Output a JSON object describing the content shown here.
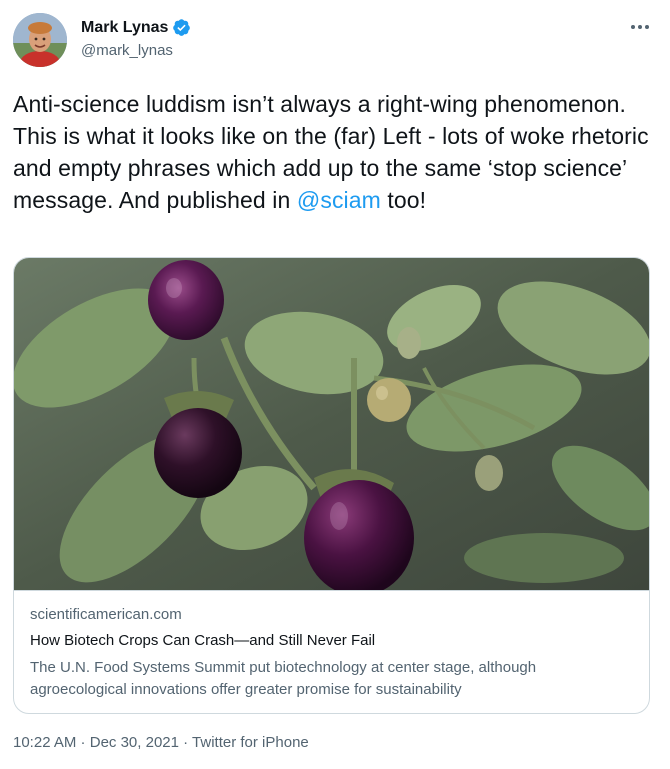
{
  "author": {
    "display_name": "Mark Lynas",
    "handle": "@mark_lynas",
    "verified_icon": "verified-badge-icon"
  },
  "menu": {
    "icon": "more-horizontal-icon"
  },
  "tweet": {
    "text_before_mention": "Anti-science luddism isn’t always a right-wing phenomenon. This is what it looks like on the (far) Left - lots of woke rhetoric and empty phrases which add up to the same ‘stop science’ message. And published in ",
    "mention": "@sciam",
    "text_after_mention": " too!"
  },
  "card": {
    "image_subject": "eggplant-plant-photo",
    "domain": "scientificamerican.com",
    "title": "How Biotech Crops Can Crash—and Still Never Fail",
    "description": "The U.N. Food Systems Summit put biotechnology at center stage, although agroecological innovations offer greater promise for sustainability"
  },
  "meta": {
    "time": "10:22 AM",
    "separator1": " · ",
    "date": "Dec 30, 2021",
    "separator2": " · ",
    "source": "Twitter for iPhone"
  },
  "colors": {
    "link": "#1d9bf0",
    "secondary_text": "#536471",
    "primary_text": "#0f1419",
    "border": "#cfd9de"
  }
}
